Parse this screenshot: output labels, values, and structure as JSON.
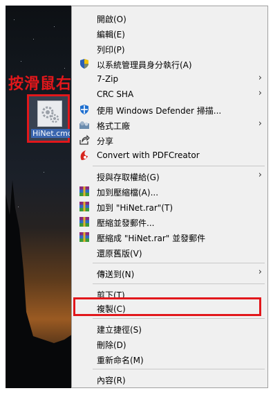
{
  "annotation": {
    "text": "按滑鼠右鍵",
    "color": "#e2171b"
  },
  "desktop_file": {
    "name": "HiNet.cmd"
  },
  "context_menu": {
    "items": [
      {
        "label": "開啟(O)",
        "icon": ""
      },
      {
        "label": "編輯(E)",
        "icon": ""
      },
      {
        "label": "列印(P)",
        "icon": ""
      },
      {
        "label": "以系統管理員身分執行(A)",
        "icon": "uac-shield-icon"
      },
      {
        "label": "7-Zip",
        "icon": "",
        "submenu": true
      },
      {
        "label": "CRC SHA",
        "icon": "",
        "submenu": true
      },
      {
        "label": "使用 Windows Defender 掃描...",
        "icon": "windows-defender-icon"
      },
      {
        "label": "格式工廠",
        "icon": "format-factory-icon",
        "submenu": true
      },
      {
        "label": "分享",
        "icon": "share-icon"
      },
      {
        "label": "Convert with PDFCreator",
        "icon": "pdfcreator-icon"
      },
      {
        "label": "授與存取權給(G)",
        "icon": "",
        "submenu": true
      },
      {
        "label": "加到壓縮檔(A)...",
        "icon": "winrar-icon"
      },
      {
        "label": "加到 \"HiNet.rar\"(T)",
        "icon": "winrar-icon"
      },
      {
        "label": "壓縮並發郵件...",
        "icon": "winrar-icon"
      },
      {
        "label": "壓縮成 \"HiNet.rar\" 並發郵件",
        "icon": "winrar-icon"
      },
      {
        "label": "還原舊版(V)",
        "icon": ""
      },
      {
        "label": "傳送到(N)",
        "icon": "",
        "submenu": true
      },
      {
        "label": "剪下(T)",
        "icon": ""
      },
      {
        "label": "複製(C)",
        "icon": "",
        "highlighted": true
      },
      {
        "label": "建立捷徑(S)",
        "icon": ""
      },
      {
        "label": "刪除(D)",
        "icon": ""
      },
      {
        "label": "重新命名(M)",
        "icon": ""
      },
      {
        "label": "內容(R)",
        "icon": ""
      }
    ],
    "submenu_arrow": "›"
  }
}
